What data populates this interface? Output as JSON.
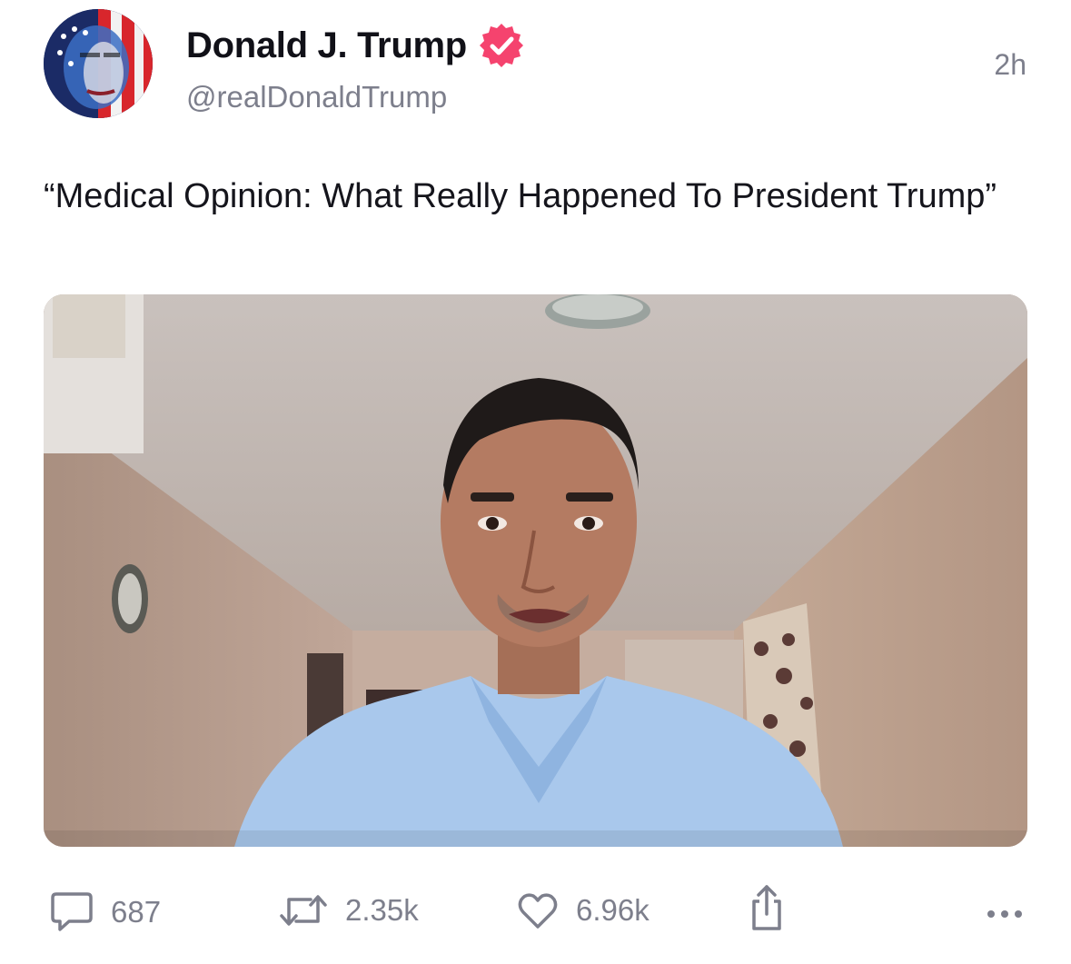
{
  "post": {
    "author": {
      "display_name": "Donald J. Trump",
      "handle": "@realDonaldTrump",
      "verified": true,
      "verified_color": "#f5436e",
      "avatar_icon": "flag-portrait-avatar"
    },
    "timestamp": "2h",
    "text": "“Medical Opinion: What Really Happened To President Trump”",
    "media": {
      "type": "video",
      "thumbnail_icon": "video-thumbnail-man-in-blue-shirt"
    },
    "actions": {
      "replies": {
        "icon": "reply-icon",
        "count": "687"
      },
      "retruths": {
        "icon": "retruth-icon",
        "count": "2.35k"
      },
      "likes": {
        "icon": "heart-icon",
        "count": "6.96k"
      },
      "share": {
        "icon": "share-icon"
      },
      "more": {
        "icon": "more-icon"
      }
    }
  },
  "colors": {
    "text_primary": "#111118",
    "text_secondary": "#7d7f8c",
    "background": "#ffffff"
  }
}
